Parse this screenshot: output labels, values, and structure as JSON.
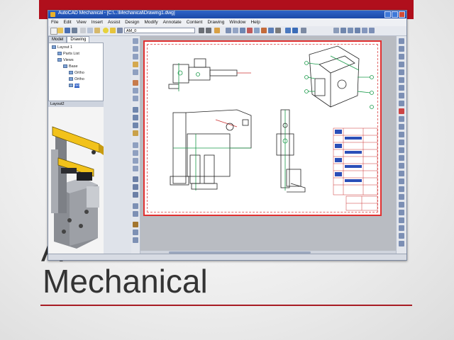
{
  "slide": {
    "title_hidden": "A",
    "title": "Mechanical",
    "accent_color": "#b00f1c"
  },
  "window": {
    "title": "AutoCAD Mechanical - [C:\\...\\Mechanical\\Drawing1.dwg]",
    "menu": [
      "File",
      "Edit",
      "View",
      "Insert",
      "Assist",
      "Design",
      "Modify",
      "Annotate",
      "Content",
      "Drawing",
      "Window",
      "Help"
    ],
    "combo_value": "AM_0",
    "tabs": [
      "Model",
      "Drawing"
    ],
    "tree": [
      {
        "label": "Layout 1",
        "level": 0
      },
      {
        "label": "Parts List",
        "level": 1
      },
      {
        "label": "Views",
        "level": 1
      },
      {
        "label": "Base",
        "level": 2
      },
      {
        "label": "Ortho",
        "level": 3
      },
      {
        "label": "Ortho",
        "level": 3
      },
      {
        "label": "Iso",
        "level": 3
      }
    ],
    "tree_bottom": "Layout2"
  }
}
